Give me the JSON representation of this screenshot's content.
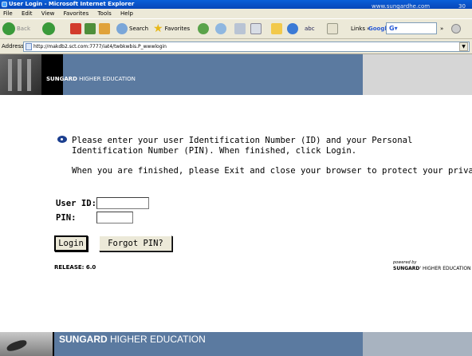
{
  "window": {
    "title": "User Login - Microsoft Internet Explorer"
  },
  "menu": [
    "File",
    "Edit",
    "View",
    "Favorites",
    "Tools",
    "Help"
  ],
  "toolbar": {
    "back": "Back",
    "search": "Search",
    "favorites": "Favorites",
    "links": "Links",
    "google": "Google",
    "google_field": "G▾"
  },
  "address": {
    "label": "Address",
    "url": "http://makdb2.sct.com:7777/iat4/twbkwbis.P_wwwlogin"
  },
  "header": {
    "brand_bold": "SUNGARD",
    "brand_rest": " HIGHER EDUCATION"
  },
  "content": {
    "instruction": "Please enter your user Identification Number (ID) and your Personal Identification Number (PIN). When finished, click Login.",
    "privacy": "When you are finished, please Exit and close your browser to protect your privacy.",
    "user_id_label": "User ID:",
    "pin_label": "PIN:",
    "login_button": "Login",
    "forgot_button": "Forgot PIN?",
    "release": "RELEASE: 6.0",
    "powered_by": "powered by",
    "powered_brand_bold": "SUNGARD",
    "powered_brand_rest": "' HIGHER EDUCATION"
  },
  "footer": {
    "brand_bold": "SUNGARD",
    "brand_rest": " HIGHER EDUCATION",
    "url": "www.sungardhe.com",
    "number": "30"
  }
}
